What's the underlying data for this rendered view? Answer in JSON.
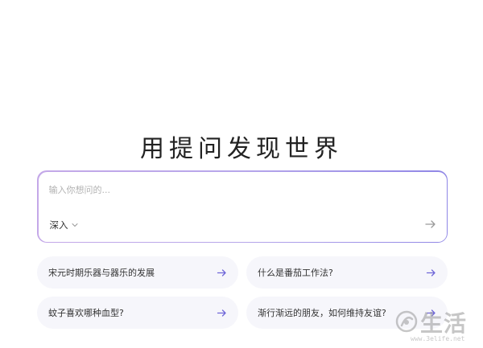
{
  "hero": {
    "title": "用提问发现世界"
  },
  "search": {
    "placeholder": "输入你想问的...",
    "value": "",
    "mode_label": "深入",
    "mode_icon": "chevron-down-icon",
    "submit_icon": "arrow-right-icon"
  },
  "suggestions": [
    {
      "label": "宋元时期乐器与器乐的发展",
      "icon": "arrow-right-icon"
    },
    {
      "label": "什么是番茄工作法?",
      "icon": "arrow-right-icon"
    },
    {
      "label": "蚊子喜欢哪种血型?",
      "icon": "arrow-right-icon"
    },
    {
      "label": "渐行渐远的朋友，如何维持友谊?",
      "icon": "arrow-right-icon"
    }
  ],
  "watermark": {
    "brand": "生活",
    "site": "www.3elife.net"
  },
  "colors": {
    "accent_start": "#c4a8e8",
    "accent_end": "#8f86e6",
    "arrow": "#6f66d8",
    "chip_bg": "#f6f6fb"
  }
}
